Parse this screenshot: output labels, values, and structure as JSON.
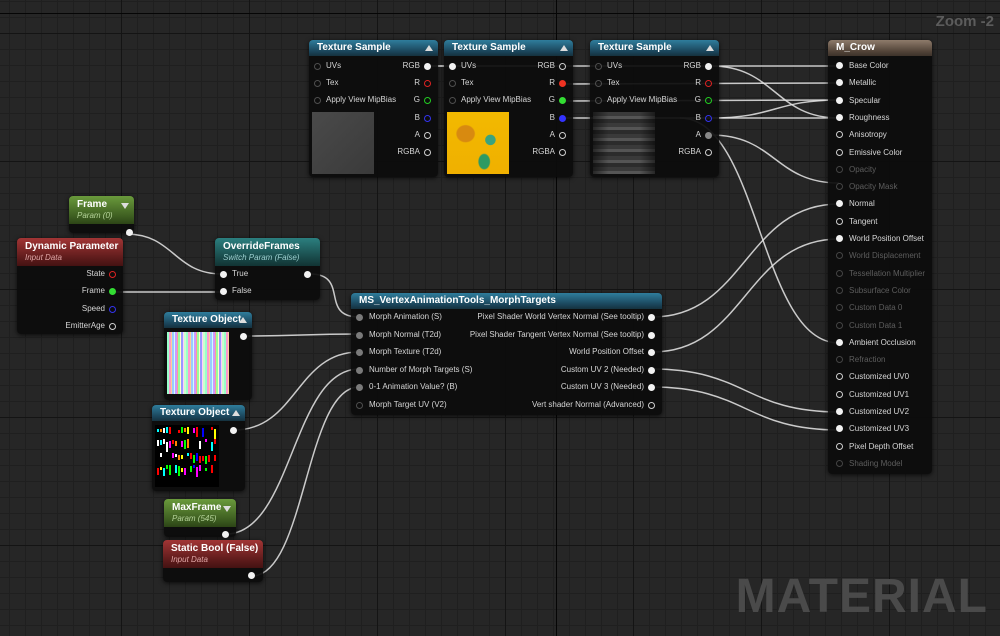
{
  "app": {
    "zoom_label": "Zoom -2",
    "watermark": "MATERIAL"
  },
  "colors": {
    "texture_header": "#1a4358",
    "param_header": "#3c5c20",
    "input_header": "#5a1a1a",
    "switch_header": "#184646",
    "result_header": "#4f4136",
    "wire": "#e8e8e8"
  },
  "nodes": {
    "tex1": {
      "title": "Texture Sample",
      "inputs": [
        "UVs",
        "Tex",
        "Apply View MipBias"
      ],
      "outputs": [
        "RGB",
        "R",
        "G",
        "B",
        "A",
        "RGBA"
      ],
      "thumbnail": "gray-texture"
    },
    "tex2": {
      "title": "Texture Sample",
      "inputs": [
        "UVs",
        "Tex",
        "Apply View MipBias"
      ],
      "outputs": [
        "RGB",
        "R",
        "G",
        "B",
        "A",
        "RGBA"
      ],
      "thumbnail": "yellow-mask-texture"
    },
    "tex3": {
      "title": "Texture Sample",
      "inputs": [
        "UVs",
        "Tex",
        "Apply View MipBias"
      ],
      "outputs": [
        "RGB",
        "R",
        "G",
        "B",
        "A",
        "RGBA"
      ],
      "thumbnail": "stone-texture"
    },
    "frame": {
      "title": "Frame",
      "subtitle": "Param (0)"
    },
    "dynparam": {
      "title": "Dynamic Parameter",
      "subtitle": "Input Data",
      "outputs": [
        "State",
        "Frame",
        "Speed",
        "EmitterAge"
      ]
    },
    "override": {
      "title": "OverrideFrames",
      "subtitle": "Switch Param (False)",
      "inputs": [
        "True",
        "False"
      ]
    },
    "texobj1": {
      "title": "Texture Object",
      "thumbnail": "striped-texture"
    },
    "texobj2": {
      "title": "Texture Object",
      "thumbnail": "glyph-texture"
    },
    "maxframe": {
      "title": "MaxFrame",
      "subtitle": "Param (545)"
    },
    "staticbool": {
      "title": "Static Bool (False)",
      "subtitle": "Input Data"
    },
    "morph": {
      "title": "MS_VertexAnimationTools_MorphTargets",
      "inputs": [
        "Morph Animation (S)",
        "Morph Normal (T2d)",
        "Morph Texture (T2d)",
        "Number of Morph Targets (S)",
        "0-1 Animation Value? (B)",
        "Morph Target UV (V2)"
      ],
      "outputs": [
        "Pixel Shader World Vertex Normal (See tooltip)",
        "Pixel Shader Tangent Vertex Normal (See tooltip)",
        "World Position Offset",
        "Custom UV 2 (Needed)",
        "Custom UV 3 (Needed)",
        "Vert shader Normal (Advanced)"
      ]
    },
    "result": {
      "title": "M_Crow",
      "inputs": [
        "Base Color",
        "Metallic",
        "Specular",
        "Roughness",
        "Anisotropy",
        "Emissive Color",
        "Opacity",
        "Opacity Mask",
        "Normal",
        "Tangent",
        "World Position Offset",
        "World Displacement",
        "Tessellation Multiplier",
        "Subsurface Color",
        "Custom Data 0",
        "Custom Data 1",
        "Ambient Occlusion",
        "Refraction",
        "Customized UV0",
        "Customized UV1",
        "Customized UV2",
        "Customized UV3",
        "Pixel Depth Offset",
        "Shading Model"
      ]
    }
  }
}
